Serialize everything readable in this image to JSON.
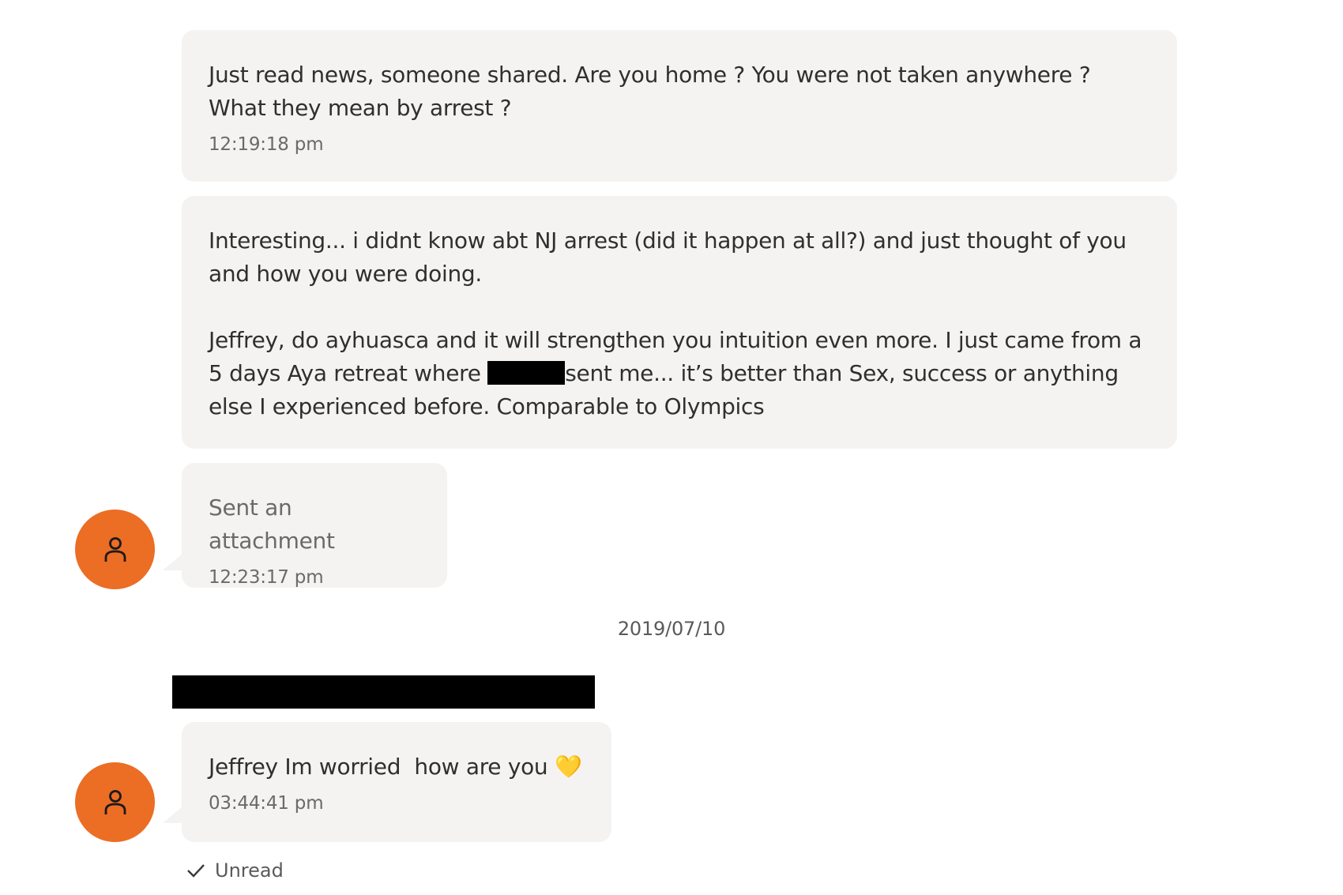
{
  "messages": [
    {
      "text": "Just read news, someone shared. Are you home ? You were not taken anywhere ? What they mean by arrest ?",
      "time": "12:19:18 pm"
    },
    {
      "text_line1": "Interesting... i didnt know abt NJ arrest (did it happen at all?) and just thought of you and how you were doing.",
      "text_before_redaction": "Jeffrey, do ayhuasca and it will strengthen you intuition even more. I just came from a 5 days Aya retreat where ",
      "text_after_redaction": "sent me... it’s better than Sex, success or anything else I experienced before. Comparable to Olympics"
    },
    {
      "text": "Sent an attachment",
      "time": "12:23:17 pm"
    },
    {
      "text": "Jeffrey Im worried  how are you",
      "emoji": "💛",
      "time": "03:44:41 pm"
    }
  ],
  "date_divider": "2019/07/10",
  "status": "Unread",
  "colors": {
    "avatar": "#ec6d24",
    "bubble": "#f4f3f1",
    "redaction": "#000000"
  },
  "icons": {
    "avatar": "user-icon",
    "status": "checkmark-icon",
    "emoji": "yellow-heart"
  }
}
